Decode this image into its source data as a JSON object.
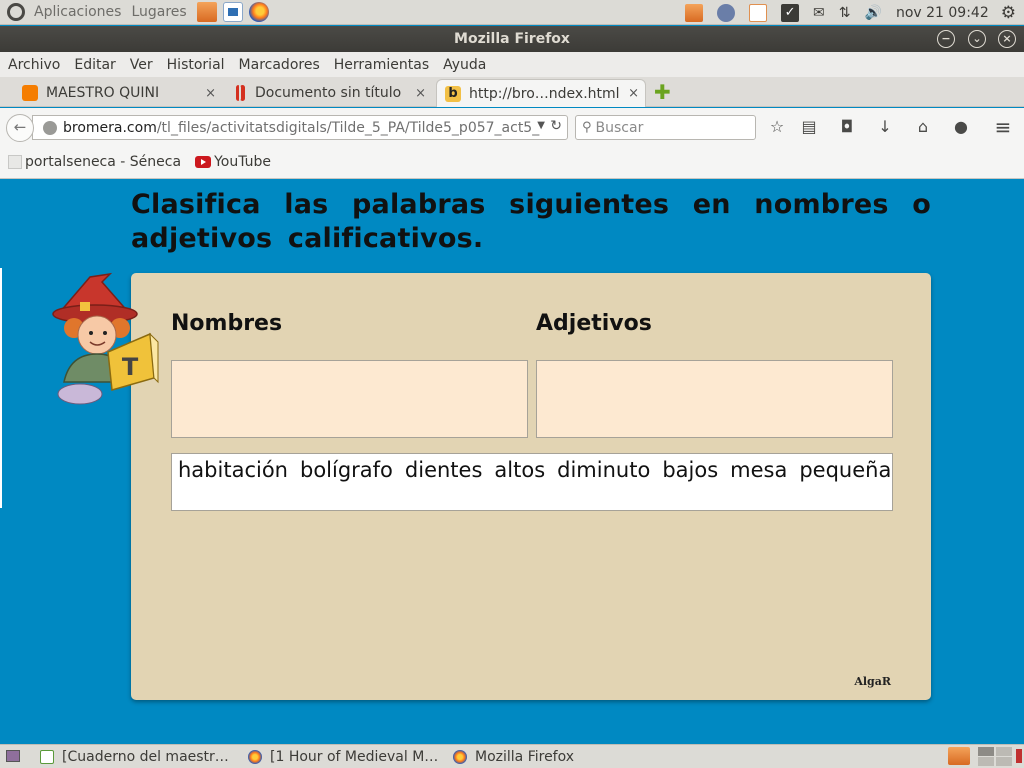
{
  "top_panel": {
    "menus": [
      "Aplicaciones",
      "Lugares"
    ],
    "clock": "nov 21 09:42",
    "volume_glyph": "🔊",
    "network_glyph": "⇅",
    "mail_glyph": "✉"
  },
  "window": {
    "title": "Mozilla Firefox",
    "controls": [
      "−",
      "⌄",
      "×"
    ]
  },
  "menu_bar": {
    "items": [
      "Archivo",
      "Editar",
      "Ver",
      "Historial",
      "Marcadores",
      "Herramientas",
      "Ayuda"
    ]
  },
  "tabs": [
    {
      "label": "MAESTRO QUINI",
      "icon": "blogger-icon",
      "active": false
    },
    {
      "label": "Documento sin título",
      "icon": "google-docs-icon",
      "active": false
    },
    {
      "label": "http://bro…ndex.html",
      "icon": "bromera-icon",
      "icon_text": "b",
      "active": true
    }
  ],
  "tab_close_glyph": "×",
  "new_tab_glyph": "✚",
  "nav": {
    "back_glyph": "←",
    "url_domain": "bromera.com",
    "url_path": "/tl_files/activitatsdigitals/Tilde_5_PA/Tilde5_p057_act5_",
    "search_placeholder": "Buscar",
    "search_glyph": "⚲",
    "toolbar_glyphs": {
      "bookmark_star": "☆",
      "reader": "▤",
      "pocket": "◘",
      "download": "↓",
      "home": "⌂",
      "chat": "●",
      "menu": "≡"
    }
  },
  "bookmarks": [
    {
      "label": "portalseneca - Séneca",
      "icon": "page-icon"
    },
    {
      "label": "YouTube",
      "icon": "youtube-icon"
    }
  ],
  "activity": {
    "instruction": "Clasifica las palabras siguientes en nombres o adjetivos calificativos.",
    "columns": [
      "Nombres",
      "Adjetivos"
    ],
    "words": [
      "habitación",
      "bolígrafo",
      "dientes",
      "altos",
      "diminuto",
      "bajos",
      "mesa",
      "pequeña"
    ],
    "publisher": "AlgaR"
  },
  "taskbar": [
    {
      "label": "[Cuaderno del maestr…",
      "icon": "spreadsheet-icon"
    },
    {
      "label": "[1 Hour of Medieval M…",
      "icon": "firefox-icon"
    },
    {
      "label": "Mozilla Firefox",
      "icon": "firefox-icon"
    }
  ],
  "colors": {
    "page_background": "#0089c2",
    "panel": "#e2d4b3",
    "drop_box": "#fde9d1",
    "accent_orange": "#f57d00"
  }
}
